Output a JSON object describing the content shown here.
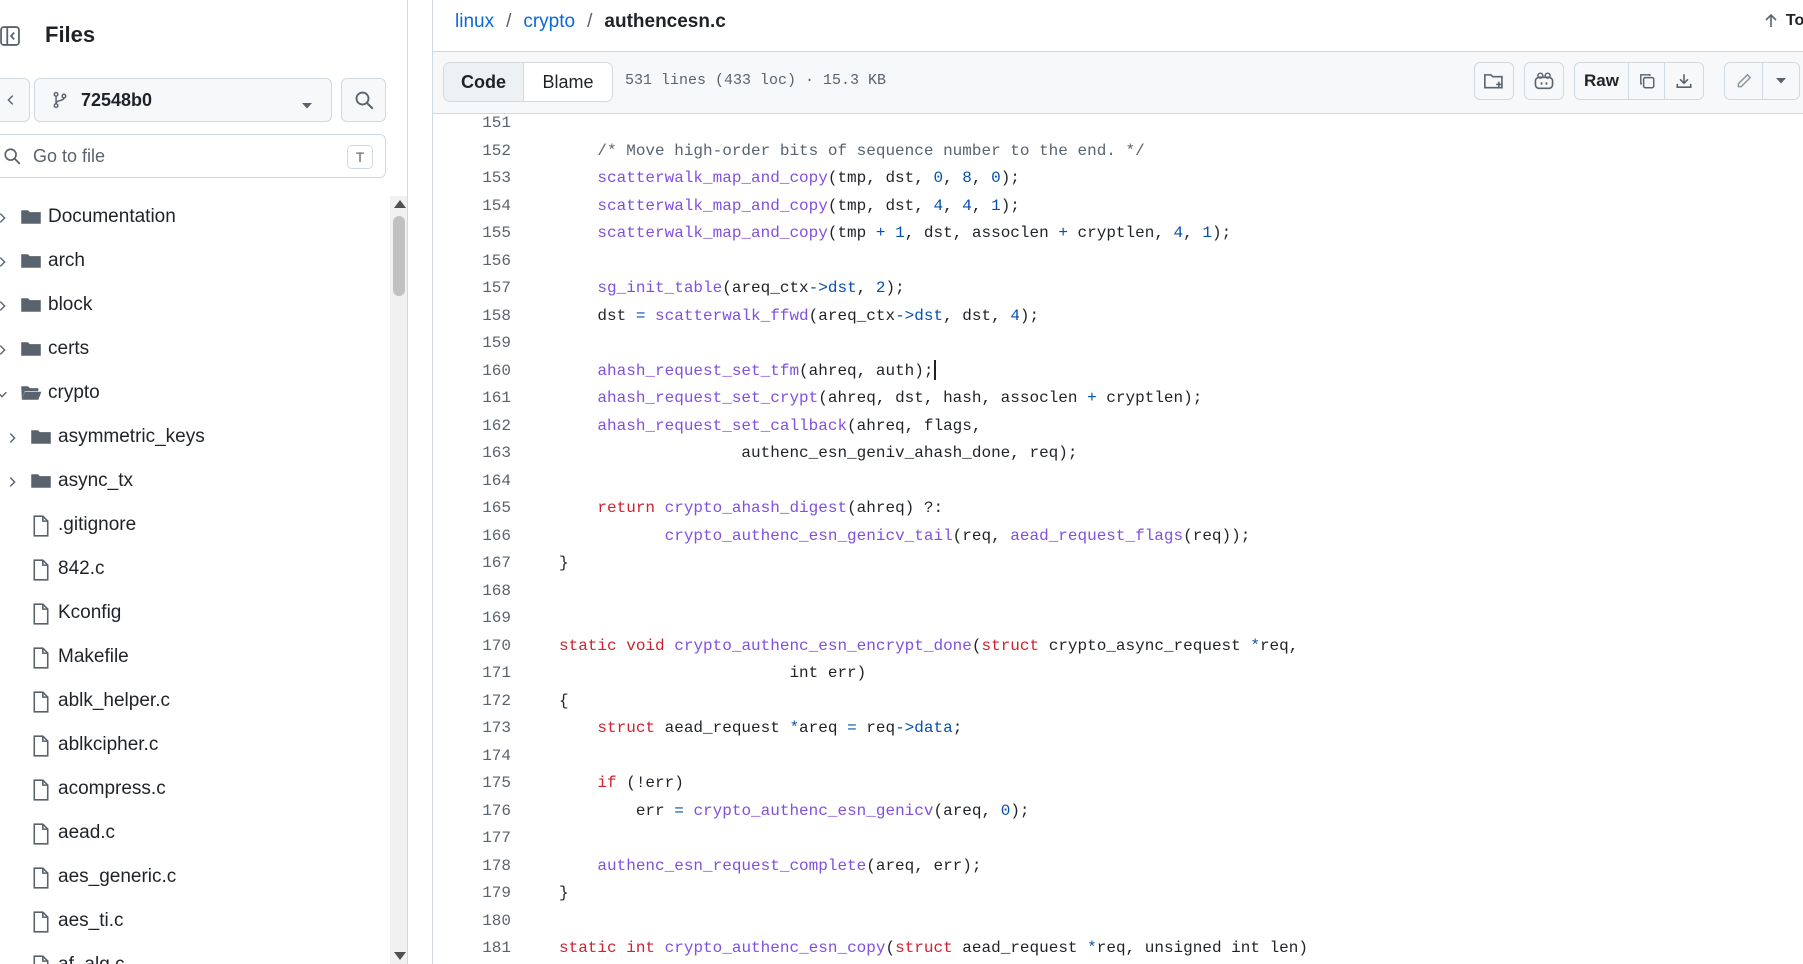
{
  "sidebar": {
    "title": "Files",
    "branch": "72548b0",
    "goto_placeholder": "Go to file",
    "goto_shortcut": "T",
    "tree": [
      {
        "name": "Documentation",
        "type": "folder",
        "depth": 0,
        "expanded": false
      },
      {
        "name": "arch",
        "type": "folder",
        "depth": 0,
        "expanded": false
      },
      {
        "name": "block",
        "type": "folder",
        "depth": 0,
        "expanded": false
      },
      {
        "name": "certs",
        "type": "folder",
        "depth": 0,
        "expanded": false
      },
      {
        "name": "crypto",
        "type": "folder",
        "depth": 0,
        "expanded": true
      },
      {
        "name": "asymmetric_keys",
        "type": "folder",
        "depth": 1,
        "expanded": false
      },
      {
        "name": "async_tx",
        "type": "folder",
        "depth": 1,
        "expanded": false
      },
      {
        "name": ".gitignore",
        "type": "file",
        "depth": 1
      },
      {
        "name": "842.c",
        "type": "file",
        "depth": 1
      },
      {
        "name": "Kconfig",
        "type": "file",
        "depth": 1
      },
      {
        "name": "Makefile",
        "type": "file",
        "depth": 1
      },
      {
        "name": "ablk_helper.c",
        "type": "file",
        "depth": 1
      },
      {
        "name": "ablkcipher.c",
        "type": "file",
        "depth": 1
      },
      {
        "name": "acompress.c",
        "type": "file",
        "depth": 1
      },
      {
        "name": "aead.c",
        "type": "file",
        "depth": 1
      },
      {
        "name": "aes_generic.c",
        "type": "file",
        "depth": 1
      },
      {
        "name": "aes_ti.c",
        "type": "file",
        "depth": 1
      },
      {
        "name": "af_alg.c",
        "type": "file",
        "depth": 1
      }
    ]
  },
  "breadcrumb": {
    "items": [
      "linux",
      "crypto"
    ],
    "separator": "/",
    "current": "authencesn.c"
  },
  "top_link": "Top",
  "toolbar": {
    "code_label": "Code",
    "blame_label": "Blame",
    "file_info": "531 lines (433 loc) · 15.3 KB",
    "raw_label": "Raw"
  },
  "colors": {
    "link": "#0969da",
    "keyword": "#cf222e",
    "function": "#8250df",
    "number": "#0550ae",
    "comment": "#59636e",
    "border": "#d1d9e0"
  },
  "code": {
    "lines": [
      {
        "n": "151",
        "tokens": []
      },
      {
        "n": "152",
        "tokens": [
          [
            "c",
            "    /* Move high-order bits of sequence number to the end. */"
          ]
        ]
      },
      {
        "n": "153",
        "tokens": [
          [
            "x",
            "    "
          ],
          [
            "f",
            "scatterwalk_map_and_copy"
          ],
          [
            "x",
            "(tmp, dst, "
          ],
          [
            "n",
            "0"
          ],
          [
            "x",
            ", "
          ],
          [
            "n",
            "8"
          ],
          [
            "x",
            ", "
          ],
          [
            "n",
            "0"
          ],
          [
            "x",
            ");"
          ]
        ]
      },
      {
        "n": "154",
        "tokens": [
          [
            "x",
            "    "
          ],
          [
            "f",
            "scatterwalk_map_and_copy"
          ],
          [
            "x",
            "(tmp, dst, "
          ],
          [
            "n",
            "4"
          ],
          [
            "x",
            ", "
          ],
          [
            "n",
            "4"
          ],
          [
            "x",
            ", "
          ],
          [
            "n",
            "1"
          ],
          [
            "x",
            ");"
          ]
        ]
      },
      {
        "n": "155",
        "tokens": [
          [
            "x",
            "    "
          ],
          [
            "f",
            "scatterwalk_map_and_copy"
          ],
          [
            "x",
            "(tmp "
          ],
          [
            "o",
            "+"
          ],
          [
            "x",
            " "
          ],
          [
            "n",
            "1"
          ],
          [
            "x",
            ", dst, assoclen "
          ],
          [
            "o",
            "+"
          ],
          [
            "x",
            " cryptlen, "
          ],
          [
            "n",
            "4"
          ],
          [
            "x",
            ", "
          ],
          [
            "n",
            "1"
          ],
          [
            "x",
            ");"
          ]
        ]
      },
      {
        "n": "156",
        "tokens": []
      },
      {
        "n": "157",
        "tokens": [
          [
            "x",
            "    "
          ],
          [
            "f",
            "sg_init_table"
          ],
          [
            "x",
            "(areq_ctx"
          ],
          [
            "o",
            "->"
          ],
          [
            "n",
            "dst"
          ],
          [
            "x",
            ", "
          ],
          [
            "n",
            "2"
          ],
          [
            "x",
            ");"
          ]
        ]
      },
      {
        "n": "158",
        "tokens": [
          [
            "x",
            "    dst "
          ],
          [
            "o",
            "="
          ],
          [
            "x",
            " "
          ],
          [
            "f",
            "scatterwalk_ffwd"
          ],
          [
            "x",
            "(areq_ctx"
          ],
          [
            "o",
            "->"
          ],
          [
            "n",
            "dst"
          ],
          [
            "x",
            ", dst, "
          ],
          [
            "n",
            "4"
          ],
          [
            "x",
            ");"
          ]
        ]
      },
      {
        "n": "159",
        "tokens": []
      },
      {
        "n": "160",
        "tokens": [
          [
            "x",
            "    "
          ],
          [
            "f",
            "ahash_request_set_tfm"
          ],
          [
            "x",
            "(ahreq, auth);"
          ]
        ],
        "caret": true
      },
      {
        "n": "161",
        "tokens": [
          [
            "x",
            "    "
          ],
          [
            "f",
            "ahash_request_set_crypt"
          ],
          [
            "x",
            "(ahreq, dst, hash, assoclen "
          ],
          [
            "o",
            "+"
          ],
          [
            "x",
            " cryptlen);"
          ]
        ]
      },
      {
        "n": "162",
        "tokens": [
          [
            "x",
            "    "
          ],
          [
            "f",
            "ahash_request_set_callback"
          ],
          [
            "x",
            "(ahreq, flags,"
          ]
        ]
      },
      {
        "n": "163",
        "tokens": [
          [
            "x",
            "                   authenc_esn_geniv_ahash_done, req);"
          ]
        ]
      },
      {
        "n": "164",
        "tokens": []
      },
      {
        "n": "165",
        "tokens": [
          [
            "x",
            "    "
          ],
          [
            "k",
            "return"
          ],
          [
            "x",
            " "
          ],
          [
            "f",
            "crypto_ahash_digest"
          ],
          [
            "x",
            "(ahreq) ?:"
          ]
        ]
      },
      {
        "n": "166",
        "tokens": [
          [
            "x",
            "           "
          ],
          [
            "f",
            "crypto_authenc_esn_genicv_tail"
          ],
          [
            "x",
            "(req, "
          ],
          [
            "f",
            "aead_request_flags"
          ],
          [
            "x",
            "(req));"
          ]
        ]
      },
      {
        "n": "167",
        "tokens": [
          [
            "x",
            "}"
          ]
        ]
      },
      {
        "n": "168",
        "tokens": []
      },
      {
        "n": "169",
        "tokens": []
      },
      {
        "n": "170",
        "tokens": [
          [
            "k",
            "static"
          ],
          [
            "x",
            " "
          ],
          [
            "k",
            "void"
          ],
          [
            "x",
            " "
          ],
          [
            "f",
            "crypto_authenc_esn_encrypt_done"
          ],
          [
            "x",
            "("
          ],
          [
            "k",
            "struct"
          ],
          [
            "x",
            " crypto_async_request "
          ],
          [
            "o",
            "*"
          ],
          [
            "x",
            "req,"
          ]
        ]
      },
      {
        "n": "171",
        "tokens": [
          [
            "x",
            "                        int err)"
          ]
        ]
      },
      {
        "n": "172",
        "tokens": [
          [
            "x",
            "{"
          ]
        ]
      },
      {
        "n": "173",
        "tokens": [
          [
            "x",
            "    "
          ],
          [
            "k",
            "struct"
          ],
          [
            "x",
            " aead_request "
          ],
          [
            "o",
            "*"
          ],
          [
            "x",
            "areq "
          ],
          [
            "o",
            "="
          ],
          [
            "x",
            " req"
          ],
          [
            "o",
            "->"
          ],
          [
            "n",
            "data"
          ],
          [
            "x",
            ";"
          ]
        ]
      },
      {
        "n": "174",
        "tokens": []
      },
      {
        "n": "175",
        "tokens": [
          [
            "x",
            "    "
          ],
          [
            "k",
            "if"
          ],
          [
            "x",
            " (!err)"
          ]
        ]
      },
      {
        "n": "176",
        "tokens": [
          [
            "x",
            "        err "
          ],
          [
            "o",
            "="
          ],
          [
            "x",
            " "
          ],
          [
            "f",
            "crypto_authenc_esn_genicv"
          ],
          [
            "x",
            "(areq, "
          ],
          [
            "n",
            "0"
          ],
          [
            "x",
            ");"
          ]
        ]
      },
      {
        "n": "177",
        "tokens": []
      },
      {
        "n": "178",
        "tokens": [
          [
            "x",
            "    "
          ],
          [
            "f",
            "authenc_esn_request_complete"
          ],
          [
            "x",
            "(areq, err);"
          ]
        ]
      },
      {
        "n": "179",
        "tokens": [
          [
            "x",
            "}"
          ]
        ]
      },
      {
        "n": "180",
        "tokens": []
      },
      {
        "n": "181",
        "tokens": [
          [
            "k",
            "static"
          ],
          [
            "x",
            " "
          ],
          [
            "k",
            "int"
          ],
          [
            "x",
            " "
          ],
          [
            "f",
            "crypto_authenc_esn_copy"
          ],
          [
            "x",
            "("
          ],
          [
            "k",
            "struct"
          ],
          [
            "x",
            " aead_request "
          ],
          [
            "o",
            "*"
          ],
          [
            "x",
            "req, unsigned int len)"
          ]
        ]
      }
    ]
  }
}
